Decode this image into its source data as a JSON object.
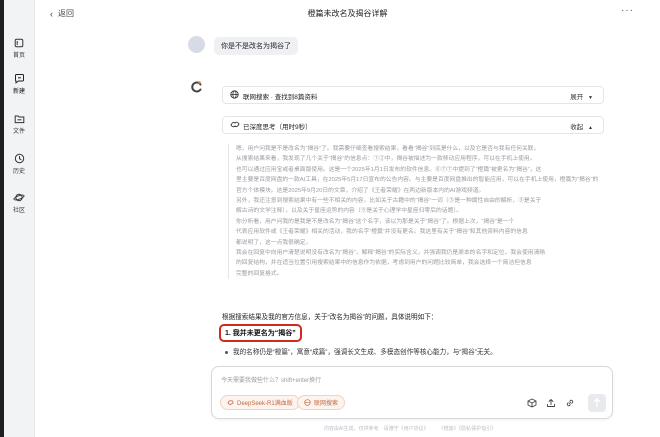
{
  "header": {
    "back_label": "返回",
    "title": "橙篇未改名及揭谷详解",
    "more_label": "···"
  },
  "sidebar": {
    "items": [
      {
        "label": "首页",
        "icon": "home-icon"
      },
      {
        "label": "新建",
        "icon": "new-chat-icon"
      },
      {
        "label": "文件",
        "icon": "folder-icon"
      },
      {
        "label": "历史",
        "icon": "clock-icon"
      },
      {
        "label": "社区",
        "icon": "planet-icon"
      }
    ]
  },
  "conversation": {
    "user_message": "你是不是改名为揭谷了",
    "search_card": {
      "label": "联网搜索 · 查找到8篇资料",
      "action": "展开"
    },
    "thinking_card": {
      "label": "已深度思考（用时9秒）",
      "action": "收起"
    },
    "thinking_text": [
      "嗯，用户问我是不是改名为“揭谷”了。我需要仔细查看搜索结果，看看“揭谷”到底是什么，以及它是否与我有任何关联。",
      "从搜索结果来看，我发现了几个关于“揭谷”的信息点：①②中，揭谷被描述为一款移动应用程序，可以在手机上使用。",
      "也可以通过应用宝或者桌面版使用。这是一个2025年1月1日发布的软件信息。⑥⑦⑦中提到了“橙篇”被更名为“揭谷”，这",
      "里主要是百度网盘的一款AI工具，在2025年5月17日宣布的公告内容。与主要是百度网盘推出的智能应用，可以在手机上使用，橙篇为“揭谷”的",
      "官方个体模块。这是2025年9月20日的文章，介绍了《王者荣耀》在两边新版本内的AI游戏频道。",
      "另外，我还注意到搜索结果中有一些不相关的内容，比如关于古籍中的“揭谷”一词（③是一种属性自由的解析，③是关于",
      "解古诗的文学注释），以及关于星座运势的内容（⑤是关于心理学中星座归零后的话题）。",
      "你分析看，用户问我的是我是不是改名为“揭谷”这个名字，该以为那是关于“揭谷”了。根据上次，“揭谷”是一个",
      "代表应用软件或《王者荣耀》相关的活动，我的名字“橙篇”并没有更名。我这里有关于“揭谷”和其他资料内容的信息",
      "都说明了，这一点我很确定。",
      "我会在回复中向用户清楚说明没有改名为“揭谷”，解释“揭谷”的实际含义，并强调我仍是原本的名字和定位。我会使用清晰",
      "的回复结构，并在适当位置引用搜索结果中的信息作为依据，考虑到用户的问题比较简单，我会选择一个简洁但信息",
      "完整的回复格式。"
    ],
    "answer_intro": "根据搜索结果及我的官方信息，关于“改名为揭谷”的问题，具体说明如下：",
    "answer_heading": "1. 我并未更名为“揭谷”",
    "answer_bullet": "我的名称仍是“橙篇”，寓意“成篇”，强调长文生成、多模态创作等核心能力，与“揭谷”无关。"
  },
  "composer": {
    "placeholder": "今天需要我做些什么？shift+enter换行",
    "pill_deepseek": "DeepSeek-R1满血版",
    "pill_search": "联网搜索"
  },
  "footer": {
    "text": "内容由AI生成，仅供参考　请遵守《用户协议》　　　《橙篇》《隐私保护指引》"
  },
  "colors": {
    "accent": "#c4683f",
    "highlight_border": "#d02a1f",
    "sidebar_bg": "#f2f3f5"
  }
}
